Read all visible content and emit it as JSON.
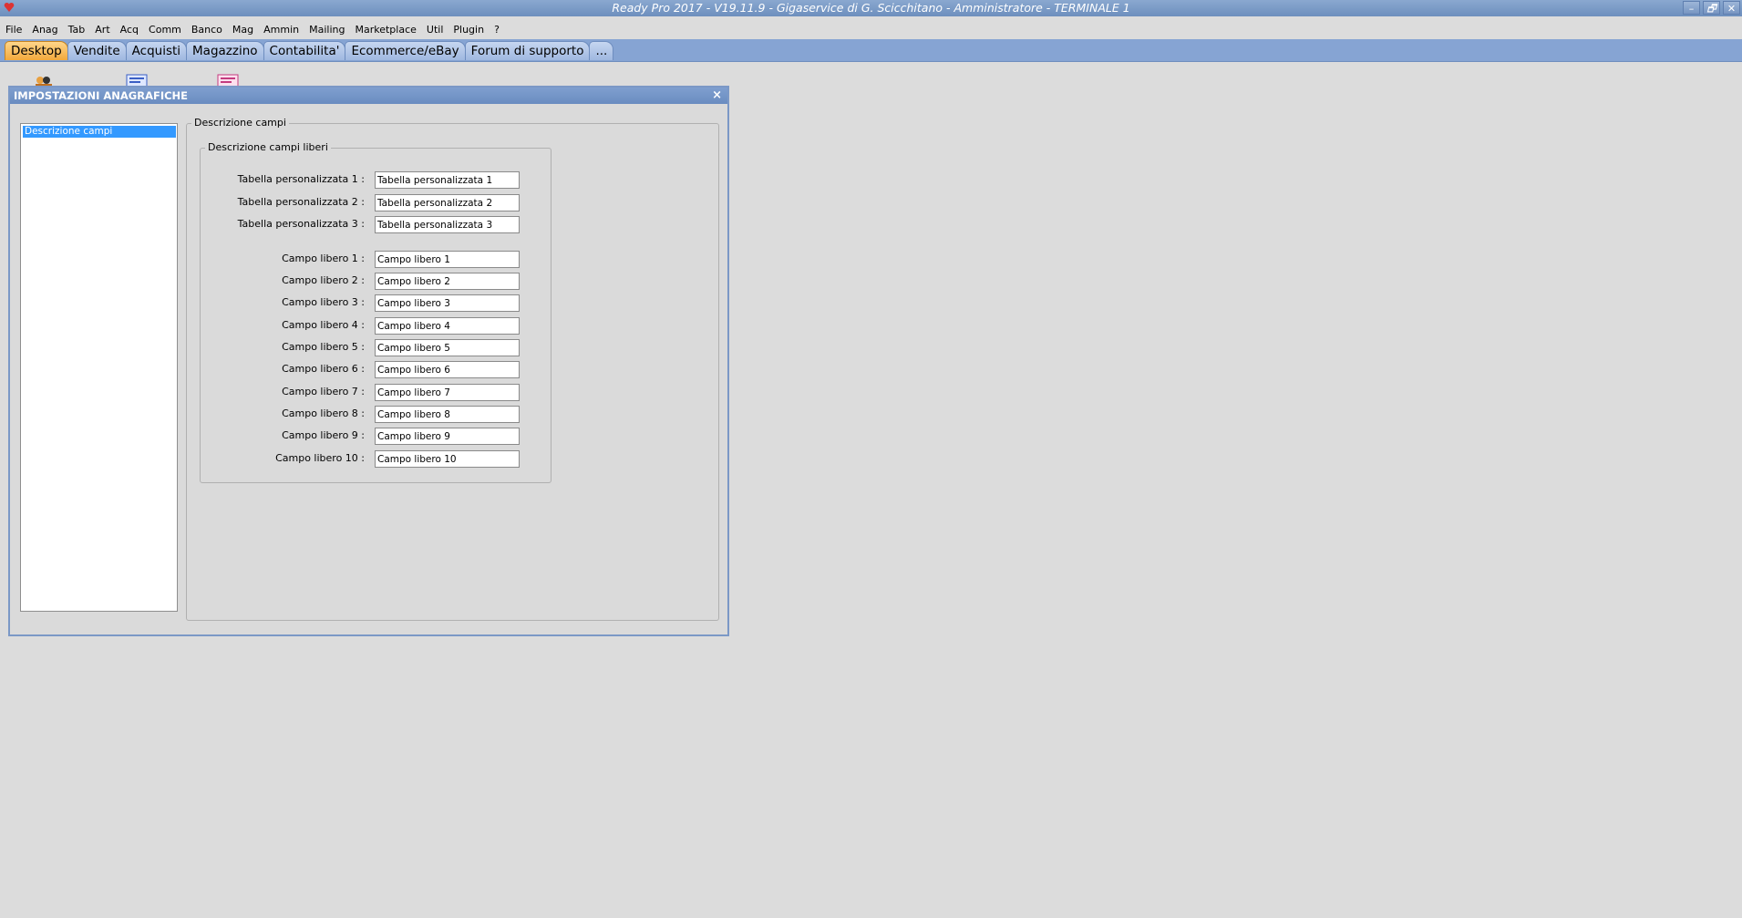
{
  "window": {
    "title": "Ready Pro 2017 - V19.11.9 - Gigaservice di G. Scicchitano - Amministratore - TERMINALE 1",
    "controls": [
      "–",
      "🗗",
      "✕"
    ]
  },
  "menu": [
    "File",
    "Anag",
    "Tab",
    "Art",
    "Acq",
    "Comm",
    "Banco",
    "Mag",
    "Ammin",
    "Mailing",
    "Marketplace",
    "Util",
    "Plugin",
    "?"
  ],
  "tabs": [
    {
      "label": "Desktop",
      "active": true
    },
    {
      "label": "Vendite",
      "active": false
    },
    {
      "label": "Acquisti",
      "active": false
    },
    {
      "label": "Magazzino",
      "active": false
    },
    {
      "label": "Contabilita'",
      "active": false
    },
    {
      "label": "Ecommerce/eBay",
      "active": false
    },
    {
      "label": "Forum di supporto",
      "active": false
    },
    {
      "label": "...",
      "active": false
    }
  ],
  "dialog": {
    "title": "IMPOSTAZIONI ANAGRAFICHE",
    "close": "×",
    "list": {
      "selected": "Descrizione campi"
    },
    "outer_group": "Descrizione campi",
    "inner_group": "Descrizione campi liberi",
    "fields": [
      {
        "label": "Tabella personalizzata 1 :",
        "value": "Tabella personalizzata 1"
      },
      {
        "label": "Tabella personalizzata 2 :",
        "value": "Tabella personalizzata 2"
      },
      {
        "label": "Tabella personalizzata 3 :",
        "value": "Tabella personalizzata 3"
      },
      {
        "label": "Campo libero 1 :",
        "value": "Campo libero 1"
      },
      {
        "label": "Campo libero 2 :",
        "value": "Campo libero 2"
      },
      {
        "label": "Campo libero 3 :",
        "value": "Campo libero 3"
      },
      {
        "label": "Campo libero 4 :",
        "value": "Campo libero 4"
      },
      {
        "label": "Campo libero 5 :",
        "value": "Campo libero 5"
      },
      {
        "label": "Campo libero 6 :",
        "value": "Campo libero 6"
      },
      {
        "label": "Campo libero 7 :",
        "value": "Campo libero 7"
      },
      {
        "label": "Campo libero 8 :",
        "value": "Campo libero 8"
      },
      {
        "label": "Campo libero 9 :",
        "value": "Campo libero 9"
      },
      {
        "label": "Campo libero 10 :",
        "value": "Campo libero 10"
      }
    ]
  },
  "colors": {
    "tabbar": "#86a4d3",
    "active_tab": "#f2a93c",
    "selection": "#3399ff"
  }
}
